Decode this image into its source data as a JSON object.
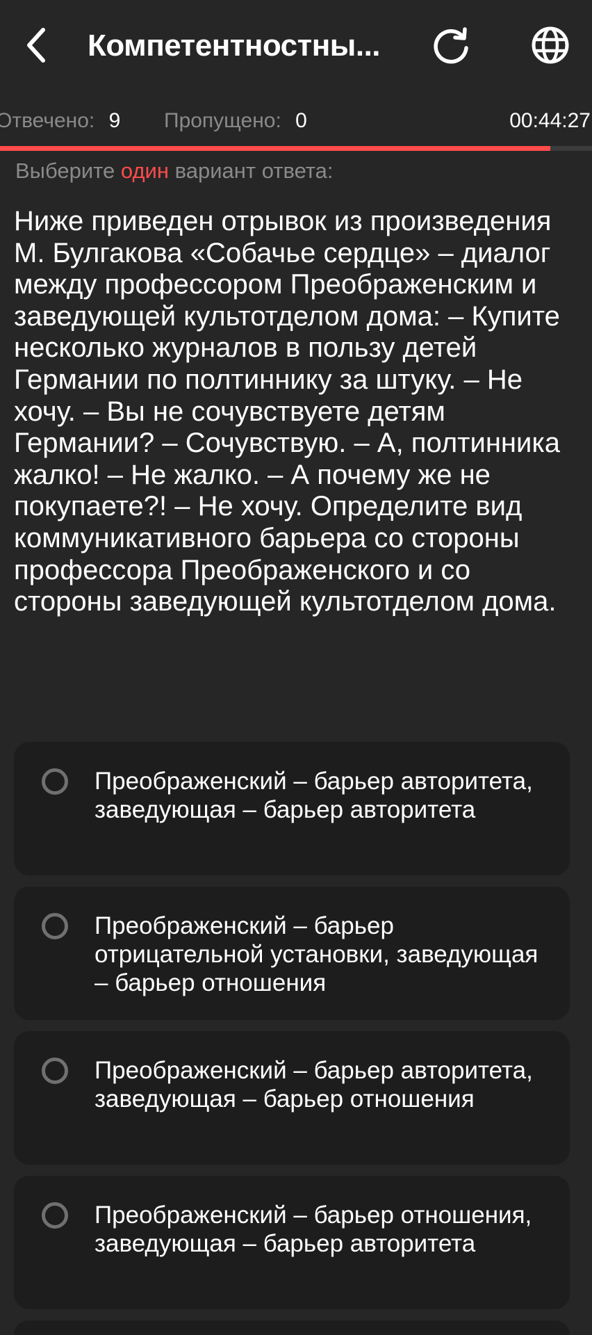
{
  "header": {
    "title": "Компетентностны...",
    "back_icon": "chevron-left-icon",
    "refresh_icon": "refresh-icon",
    "language_icon": "globe-icon"
  },
  "stats": {
    "answered_label": "Отвечено:",
    "answered_value": "9",
    "skipped_label": "Пропущено:",
    "skipped_value": "0",
    "timer": "00:44:27",
    "progress_fraction": 0.93
  },
  "instruction": {
    "prefix": "Выберите",
    "highlight": "один",
    "suffix": "вариант ответа:"
  },
  "question": {
    "text": "Ниже приведен отрывок из произведения М. Булгакова «Собачье сердце» – диалог между профессором Преображенским и заведующей культотделом дома: – Купите несколько журналов в пользу детей Германии по полтиннику за штуку. – Не хочу. – Вы не сочувствуете детям Германии? – Сочувствую. – А, полтинника жалко! – Не жалко. – А почему же не покупаете?! – Не хочу. Определите вид коммуникативного барьера со стороны профессора Преображенского и со стороны заведующей культотделом дома."
  },
  "options": [
    {
      "label": "Преображенский – барьер авторитета, заведующая – барьер авторитета",
      "selected": false
    },
    {
      "label": "Преображенский – барьер отрицательной установки, заведующая – барьер отношения",
      "selected": false
    },
    {
      "label": "Преображенский – барьер авторитета, заведующая – барьер отношения",
      "selected": false
    },
    {
      "label": "Преображенский – барьер отношения, заведующая – барьер авторитета",
      "selected": false
    }
  ],
  "colors": {
    "background": "#262626",
    "card": "#1d1d1d",
    "accent": "#ff4b4b",
    "muted_text": "#8a8a8a"
  }
}
